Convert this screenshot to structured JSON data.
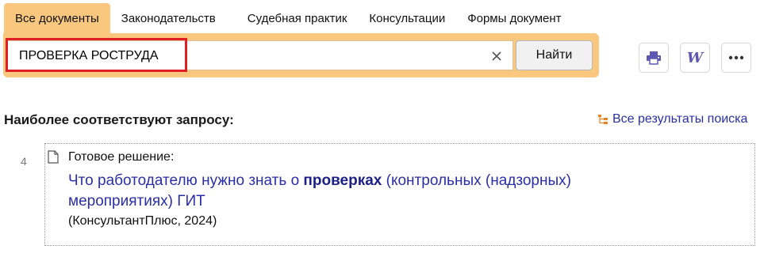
{
  "tabs": [
    {
      "label": "Все документы",
      "active": true
    },
    {
      "label": "Законодательств",
      "active": false
    },
    {
      "label": "Судебная практик",
      "active": false
    },
    {
      "label": "Консультации",
      "active": false
    },
    {
      "label": "Формы документ",
      "active": false
    }
  ],
  "search": {
    "value": "ПРОВЕРКА РОСТРУДА",
    "submit_label": "Найти"
  },
  "toolbar": {
    "print_icon": "printer-icon",
    "word_icon": "word-export-icon",
    "word_glyph": "W",
    "more_icon": "more-dots-icon"
  },
  "results_header": {
    "title": "Наиболее соответствуют запросу:",
    "all_results_label": "Все результаты поиска"
  },
  "results": [
    {
      "number": "4",
      "kind": "Готовое решение:",
      "title_before": "Что работодателю нужно знать о ",
      "title_bold": "проверках",
      "title_after": " (контрольных (надзорных) мероприятиях) ГИТ",
      "source": "(КонсультантПлюс, 2024)"
    }
  ],
  "colors": {
    "accent": "#f9c77e",
    "link": "#2a2fa8",
    "highlight": "#e01e25"
  }
}
